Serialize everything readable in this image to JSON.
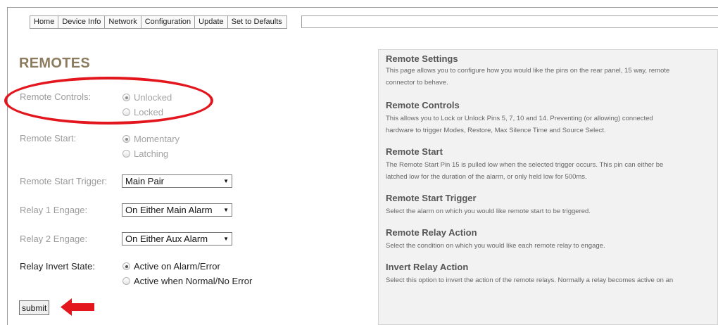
{
  "nav": [
    "Home",
    "Device Info",
    "Network",
    "Configuration",
    "Update",
    "Set to Defaults"
  ],
  "page_title": "REMOTES",
  "form": {
    "remote_controls": {
      "label": "Remote Controls:",
      "options": [
        "Unlocked",
        "Locked"
      ],
      "selected": "Unlocked"
    },
    "remote_start": {
      "label": "Remote Start:",
      "options": [
        "Momentary",
        "Latching"
      ],
      "selected": "Momentary"
    },
    "remote_start_trigger": {
      "label": "Remote Start Trigger:",
      "value": "Main Pair"
    },
    "relay1": {
      "label": "Relay 1 Engage:",
      "value": "On Either Main Alarm"
    },
    "relay2": {
      "label": "Relay 2 Engage:",
      "value": "On Either Aux Alarm"
    },
    "relay_invert": {
      "label": "Relay Invert State:",
      "options": [
        "Active on Alarm/Error",
        "Active when Normal/No Error"
      ],
      "selected": "Active on Alarm/Error"
    },
    "submit_label": "submit"
  },
  "help": {
    "title": "Remote Settings",
    "intro_1": "This page allows you to configure how you would like the pins on the rear panel, 15 way, remote",
    "intro_2": "connector to behave.",
    "sections": [
      {
        "heading": "Remote Controls",
        "line1": "This allows you to Lock or Unlock Pins 5, 7, 10 and 14. Preventing (or allowing) connected",
        "line2": "hardware to trigger Modes, Restore, Max Silence Time and Source Select."
      },
      {
        "heading": "Remote Start",
        "line1": "The Remote Start Pin 15 is pulled low when the selected trigger occurs. This pin can either be",
        "line2": "latched low for the duration of the alarm, or only held low for 500ms."
      },
      {
        "heading": "Remote Start Trigger",
        "line1": "Select the alarm on which you would like remote start to be triggered."
      },
      {
        "heading": "Remote Relay Action",
        "line1": "Select the condition on which you would like each remote relay to engage."
      },
      {
        "heading": "Invert Relay Action",
        "line1": "Select this option to invert the action of the remote relays. Normally a relay becomes active on an"
      }
    ]
  },
  "colors": {
    "title": "#8c7b5e",
    "annotation": "#e3161e",
    "panel": "#f2f2f2"
  }
}
